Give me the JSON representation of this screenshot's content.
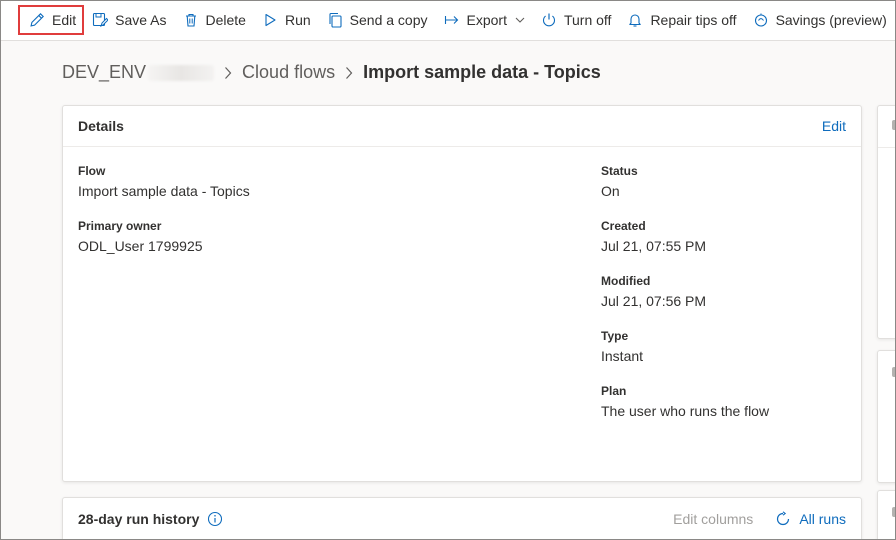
{
  "toolbar": {
    "items": [
      {
        "label": "Edit",
        "icon": "pencil-icon"
      },
      {
        "label": "Save As",
        "icon": "save-as-icon"
      },
      {
        "label": "Delete",
        "icon": "trash-icon"
      },
      {
        "label": "Run",
        "icon": "play-icon"
      },
      {
        "label": "Send a copy",
        "icon": "copy-icon"
      },
      {
        "label": "Export",
        "icon": "export-arrow-icon"
      },
      {
        "label": "Turn off",
        "icon": "power-icon"
      },
      {
        "label": "Repair tips off",
        "icon": "bell-icon"
      },
      {
        "label": "Savings (preview)",
        "icon": "savings-icon"
      }
    ],
    "highlight_color": "#e03c3c"
  },
  "breadcrumb": {
    "env": "DEV_ENV",
    "section": "Cloud flows",
    "current": "Import sample data - Topics"
  },
  "details": {
    "title": "Details",
    "edit_link": "Edit",
    "left": [
      {
        "label": "Flow",
        "value": "Import sample data - Topics"
      },
      {
        "label": "Primary owner",
        "value": "ODL_User 1799925"
      }
    ],
    "right": [
      {
        "label": "Status",
        "value": "On"
      },
      {
        "label": "Created",
        "value": "Jul 21, 07:55 PM"
      },
      {
        "label": "Modified",
        "value": "Jul 21, 07:56 PM"
      },
      {
        "label": "Type",
        "value": "Instant"
      },
      {
        "label": "Plan",
        "value": "The user who runs the flow"
      }
    ]
  },
  "run_history": {
    "title": "28-day run history",
    "edit_columns": "Edit columns",
    "all_runs": "All runs"
  },
  "colors": {
    "link": "#0f6cbd",
    "text": "#323130",
    "muted": "#a19f9d",
    "background": "#faf9f8"
  }
}
